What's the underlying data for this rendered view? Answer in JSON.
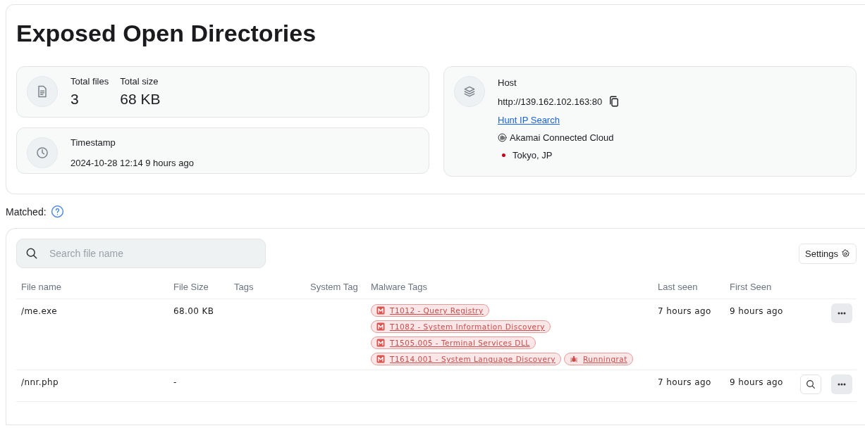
{
  "page_title": "Exposed Open Directories",
  "summary": {
    "total_files_label": "Total files",
    "total_files": "3",
    "total_size_label": "Total size",
    "total_size": "68 KB"
  },
  "timestamp": {
    "label": "Timestamp",
    "value": "2024-10-28 12:14 9 hours ago"
  },
  "host": {
    "label": "Host",
    "url": "http://139.162.102.163:80",
    "link": "Hunt IP Search",
    "provider": "Akamai Connected Cloud",
    "location": "Tokyo, JP"
  },
  "matched_label": "Matched:",
  "search": {
    "placeholder": "Search file name"
  },
  "settings_button": "Settings",
  "table": {
    "columns": [
      "File name",
      "File Size",
      "Tags",
      "System Tag",
      "Malware Tags",
      "Last seen",
      "First Seen"
    ],
    "rows": [
      {
        "file_name": "/me.exe",
        "file_size": "68.00 KB",
        "malware_tags": [
          {
            "kind": "technique",
            "label": "T1012 - Query Registry"
          },
          {
            "kind": "technique",
            "label": "T1082 - System Information Discovery"
          },
          {
            "kind": "technique",
            "label": "T1505.005 - Terminal Services DLL"
          },
          {
            "kind": "technique",
            "label": "T1614.001 - System Language Discovery"
          },
          {
            "kind": "family",
            "label": "Runningrat"
          }
        ],
        "last_seen": "7 hours ago",
        "first_seen": "9 hours ago",
        "search_button": false
      },
      {
        "file_name": "/nnr.php",
        "file_size": "-",
        "malware_tags": [],
        "last_seen": "7 hours ago",
        "first_seen": "9 hours ago",
        "search_button": true
      }
    ]
  }
}
